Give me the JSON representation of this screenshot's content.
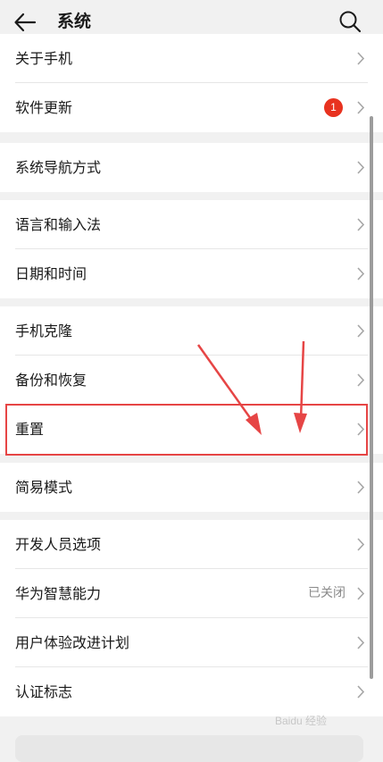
{
  "header": {
    "title": "系统",
    "back_icon": "back-arrow-icon",
    "search_icon": "search-icon"
  },
  "sections": [
    {
      "rows": [
        {
          "label": "关于手机"
        },
        {
          "label": "软件更新",
          "badge": "1"
        }
      ]
    },
    {
      "rows": [
        {
          "label": "系统导航方式"
        }
      ]
    },
    {
      "rows": [
        {
          "label": "语言和输入法"
        },
        {
          "label": "日期和时间"
        }
      ]
    },
    {
      "rows": [
        {
          "label": "手机克隆"
        },
        {
          "label": "备份和恢复"
        },
        {
          "label": "重置"
        }
      ]
    },
    {
      "rows": [
        {
          "label": "简易模式"
        }
      ]
    },
    {
      "rows": [
        {
          "label": "开发人员选项"
        },
        {
          "label": "华为智慧能力",
          "status": "已关闭"
        },
        {
          "label": "用户体验改进计划"
        },
        {
          "label": "认证标志"
        }
      ]
    }
  ],
  "annotation": {
    "color": "#e64545"
  },
  "watermark": "Baidu 经验"
}
